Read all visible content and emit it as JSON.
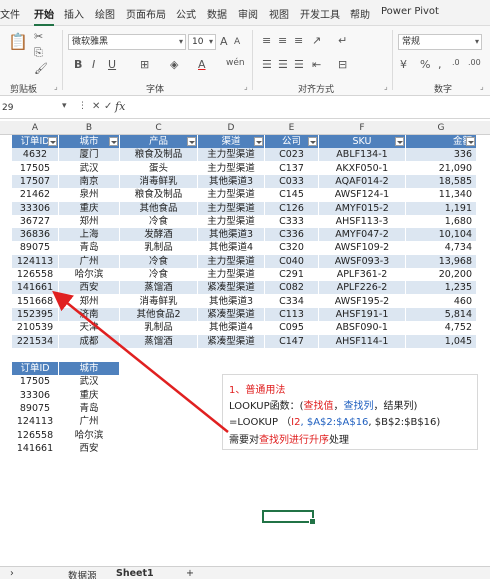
{
  "tabs": [
    "文件",
    "开始",
    "插入",
    "绘图",
    "页面布局",
    "公式",
    "数据",
    "审阅",
    "视图",
    "开发工具",
    "帮助",
    "Power Pivot"
  ],
  "ribbon": {
    "font_name": "微软雅黑",
    "font_size": "10",
    "number_format": "常规",
    "groups": [
      "剪贴板",
      "字体",
      "对齐方式",
      "数字"
    ]
  },
  "namebox": "29",
  "columns": [
    "A",
    "B",
    "C",
    "D",
    "E",
    "F",
    "G"
  ],
  "table1": {
    "headers": [
      "订单ID",
      "城市",
      "产品",
      "渠道",
      "公司",
      "SKU",
      "金额"
    ],
    "rows": [
      [
        "4632",
        "厦门",
        "粮食及制品",
        "主力型渠道",
        "C023",
        "ABLF134-1",
        "336"
      ],
      [
        "17505",
        "武汉",
        "蛋头",
        "主力型渠道",
        "C137",
        "AKXF050-1",
        "21,090"
      ],
      [
        "17507",
        "南京",
        "消毒鲜乳",
        "其他渠道3",
        "C033",
        "AQAF014-2",
        "18,585"
      ],
      [
        "21462",
        "泉州",
        "粮食及制品",
        "主力型渠道",
        "C145",
        "AWSF124-1",
        "11,340"
      ],
      [
        "33306",
        "重庆",
        "其他食品",
        "主力型渠道",
        "C126",
        "AMYF015-2",
        "1,191"
      ],
      [
        "36727",
        "郑州",
        "冷食",
        "主力型渠道",
        "C333",
        "AHSF113-3",
        "1,680"
      ],
      [
        "36836",
        "上海",
        "发酵酒",
        "其他渠道3",
        "C336",
        "AMYF047-2",
        "10,104"
      ],
      [
        "89075",
        "青岛",
        "乳制品",
        "其他渠道4",
        "C320",
        "AWSF109-2",
        "4,734"
      ],
      [
        "124113",
        "广州",
        "冷食",
        "主力型渠道",
        "C040",
        "AWSF093-3",
        "13,968"
      ],
      [
        "126558",
        "哈尔滨",
        "冷食",
        "主力型渠道",
        "C291",
        "APLF361-2",
        "20,200"
      ],
      [
        "141661",
        "西安",
        "蒸馏酒",
        "紧凑型渠道",
        "C082",
        "APLF226-2",
        "1,235"
      ],
      [
        "151668",
        "郑州",
        "消毒鲜乳",
        "其他渠道3",
        "C334",
        "AWSF195-2",
        "460"
      ],
      [
        "152395",
        "济南",
        "其他食品2",
        "紧凑型渠道",
        "C113",
        "AHSF191-1",
        "5,814"
      ],
      [
        "210539",
        "天津",
        "乳制品",
        "其他渠道4",
        "C095",
        "ABSF090-1",
        "4,752"
      ],
      [
        "221534",
        "成都",
        "蒸馏酒",
        "紧凑型渠道",
        "C147",
        "AHSF114-1",
        "1,045"
      ]
    ]
  },
  "table2": {
    "headers": [
      "订单ID",
      "城市"
    ],
    "rows": [
      [
        "17505",
        "武汉"
      ],
      [
        "33306",
        "重庆"
      ],
      [
        "89075",
        "青岛"
      ],
      [
        "124113",
        "广州"
      ],
      [
        "126558",
        "哈尔滨"
      ],
      [
        "141661",
        "西安"
      ]
    ]
  },
  "note": {
    "line1": "1、普通用法",
    "line2_prefix": " LOOKUP函数：(",
    "line2_arg1": "查找值",
    "line2_sep1": "，",
    "line2_arg2": "查找列",
    "line2_suffix": "，结果列)",
    "line3_prefix": "=LOOKUP （",
    "line3_arg1": "I2",
    "line3_mid": ", $A$2:$A$16",
    "line3_suffix": ", $B$2:$B$16)",
    "line4_prefix": "需要对",
    "line4_red": "查找列进行升序",
    "line4_suffix": "处理"
  },
  "sheets": [
    "数据源",
    "Sheet1"
  ],
  "colors": {
    "header_blue": "#4f81bd",
    "band_blue": "#dce6f1",
    "accent_green": "#217346",
    "arrow_red": "#e02020"
  }
}
